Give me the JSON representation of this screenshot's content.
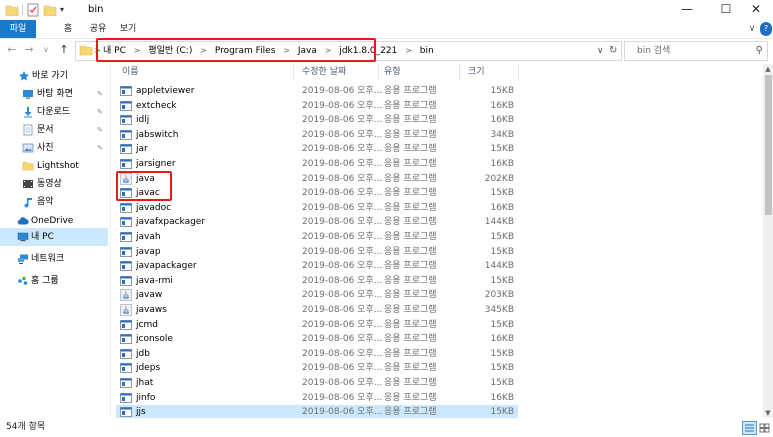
{
  "window": {
    "title": "bin",
    "controls": {
      "minimize": "—",
      "maximize": "☐",
      "close": "✕"
    }
  },
  "ribbon": {
    "tabs": [
      "파일",
      "홈",
      "공유",
      "보기"
    ],
    "expand_icon": "chevron-down-icon",
    "help": "?"
  },
  "nav": {
    "back": "←",
    "forward": "→",
    "recent": "∨",
    "up": "↑",
    "breadcrumbs": [
      "내 PC",
      "평일반 (C:)",
      "Program Files",
      "Java",
      "jdk1.8.0_221",
      "bin"
    ],
    "crumb_sep": ">",
    "addr_dropdown": "∨",
    "refresh": "↻"
  },
  "search": {
    "placeholder": "bin 검색"
  },
  "sidebar": {
    "items": [
      {
        "label": "바로 가기",
        "icon": "star-icon",
        "pinned": false
      },
      {
        "label": "바탕 화면",
        "icon": "desktop-icon",
        "pinned": true
      },
      {
        "label": "다운로드",
        "icon": "download-icon",
        "pinned": true
      },
      {
        "label": "문서",
        "icon": "document-icon",
        "pinned": true
      },
      {
        "label": "사진",
        "icon": "pictures-icon",
        "pinned": true
      },
      {
        "label": "Lightshot",
        "icon": "folder-icon",
        "pinned": false
      },
      {
        "label": "동영상",
        "icon": "video-icon",
        "pinned": false
      },
      {
        "label": "음악",
        "icon": "music-icon",
        "pinned": false
      },
      {
        "label": "OneDrive",
        "icon": "cloud-icon",
        "pinned": false
      },
      {
        "label": "내 PC",
        "icon": "computer-icon",
        "pinned": false,
        "selected": true
      },
      {
        "label": "네트워크",
        "icon": "network-icon",
        "pinned": false
      },
      {
        "label": "홈 그룹",
        "icon": "homegroup-icon",
        "pinned": false
      }
    ],
    "pin_glyph": "📌"
  },
  "columns": {
    "name": "이름",
    "date": "수정한 날짜",
    "type": "유형",
    "size": "크기"
  },
  "files": [
    {
      "name": "appletviewer",
      "date": "2019-08-06 오후...",
      "type": "응용 프로그램",
      "size": "15KB",
      "icon": "exe-icon"
    },
    {
      "name": "extcheck",
      "date": "2019-08-06 오후...",
      "type": "응용 프로그램",
      "size": "16KB",
      "icon": "exe-icon"
    },
    {
      "name": "idlj",
      "date": "2019-08-06 오후...",
      "type": "응용 프로그램",
      "size": "16KB",
      "icon": "exe-icon"
    },
    {
      "name": "jabswitch",
      "date": "2019-08-06 오후...",
      "type": "응용 프로그램",
      "size": "34KB",
      "icon": "exe-icon"
    },
    {
      "name": "jar",
      "date": "2019-08-06 오후...",
      "type": "응용 프로그램",
      "size": "15KB",
      "icon": "exe-icon"
    },
    {
      "name": "jarsigner",
      "date": "2019-08-06 오후...",
      "type": "응용 프로그램",
      "size": "16KB",
      "icon": "exe-icon"
    },
    {
      "name": "java",
      "date": "2019-08-06 오후...",
      "type": "응용 프로그램",
      "size": "202KB",
      "icon": "java-icon"
    },
    {
      "name": "javac",
      "date": "2019-08-06 오후...",
      "type": "응용 프로그램",
      "size": "15KB",
      "icon": "exe-icon"
    },
    {
      "name": "javadoc",
      "date": "2019-08-06 오후...",
      "type": "응용 프로그램",
      "size": "16KB",
      "icon": "exe-icon"
    },
    {
      "name": "javafxpackager",
      "date": "2019-08-06 오후...",
      "type": "응용 프로그램",
      "size": "144KB",
      "icon": "exe-icon"
    },
    {
      "name": "javah",
      "date": "2019-08-06 오후...",
      "type": "응용 프로그램",
      "size": "15KB",
      "icon": "exe-icon"
    },
    {
      "name": "javap",
      "date": "2019-08-06 오후...",
      "type": "응용 프로그램",
      "size": "15KB",
      "icon": "exe-icon"
    },
    {
      "name": "javapackager",
      "date": "2019-08-06 오후...",
      "type": "응용 프로그램",
      "size": "144KB",
      "icon": "exe-icon"
    },
    {
      "name": "java-rmi",
      "date": "2019-08-06 오후...",
      "type": "응용 프로그램",
      "size": "15KB",
      "icon": "exe-icon"
    },
    {
      "name": "javaw",
      "date": "2019-08-06 오후...",
      "type": "응용 프로그램",
      "size": "203KB",
      "icon": "java-icon"
    },
    {
      "name": "javaws",
      "date": "2019-08-06 오후...",
      "type": "응용 프로그램",
      "size": "345KB",
      "icon": "java-icon"
    },
    {
      "name": "jcmd",
      "date": "2019-08-06 오후...",
      "type": "응용 프로그램",
      "size": "15KB",
      "icon": "exe-icon"
    },
    {
      "name": "jconsole",
      "date": "2019-08-06 오후...",
      "type": "응용 프로그램",
      "size": "16KB",
      "icon": "exe-icon"
    },
    {
      "name": "jdb",
      "date": "2019-08-06 오후...",
      "type": "응용 프로그램",
      "size": "15KB",
      "icon": "exe-icon"
    },
    {
      "name": "jdeps",
      "date": "2019-08-06 오후...",
      "type": "응용 프로그램",
      "size": "15KB",
      "icon": "exe-icon"
    },
    {
      "name": "jhat",
      "date": "2019-08-06 오후...",
      "type": "응용 프로그램",
      "size": "15KB",
      "icon": "exe-icon"
    },
    {
      "name": "jinfo",
      "date": "2019-08-06 오후...",
      "type": "응용 프로그램",
      "size": "16KB",
      "icon": "exe-icon"
    },
    {
      "name": "jjs",
      "date": "2019-08-06 오후...",
      "type": "응용 프로그램",
      "size": "15KB",
      "icon": "exe-icon",
      "selected": true
    }
  ],
  "status": {
    "item_count": "54개 항목"
  },
  "colors": {
    "accent": "#1979ca",
    "selection": "#cce8ff",
    "highlight_box": "#e51b1b",
    "header_text": "#4c607a"
  }
}
